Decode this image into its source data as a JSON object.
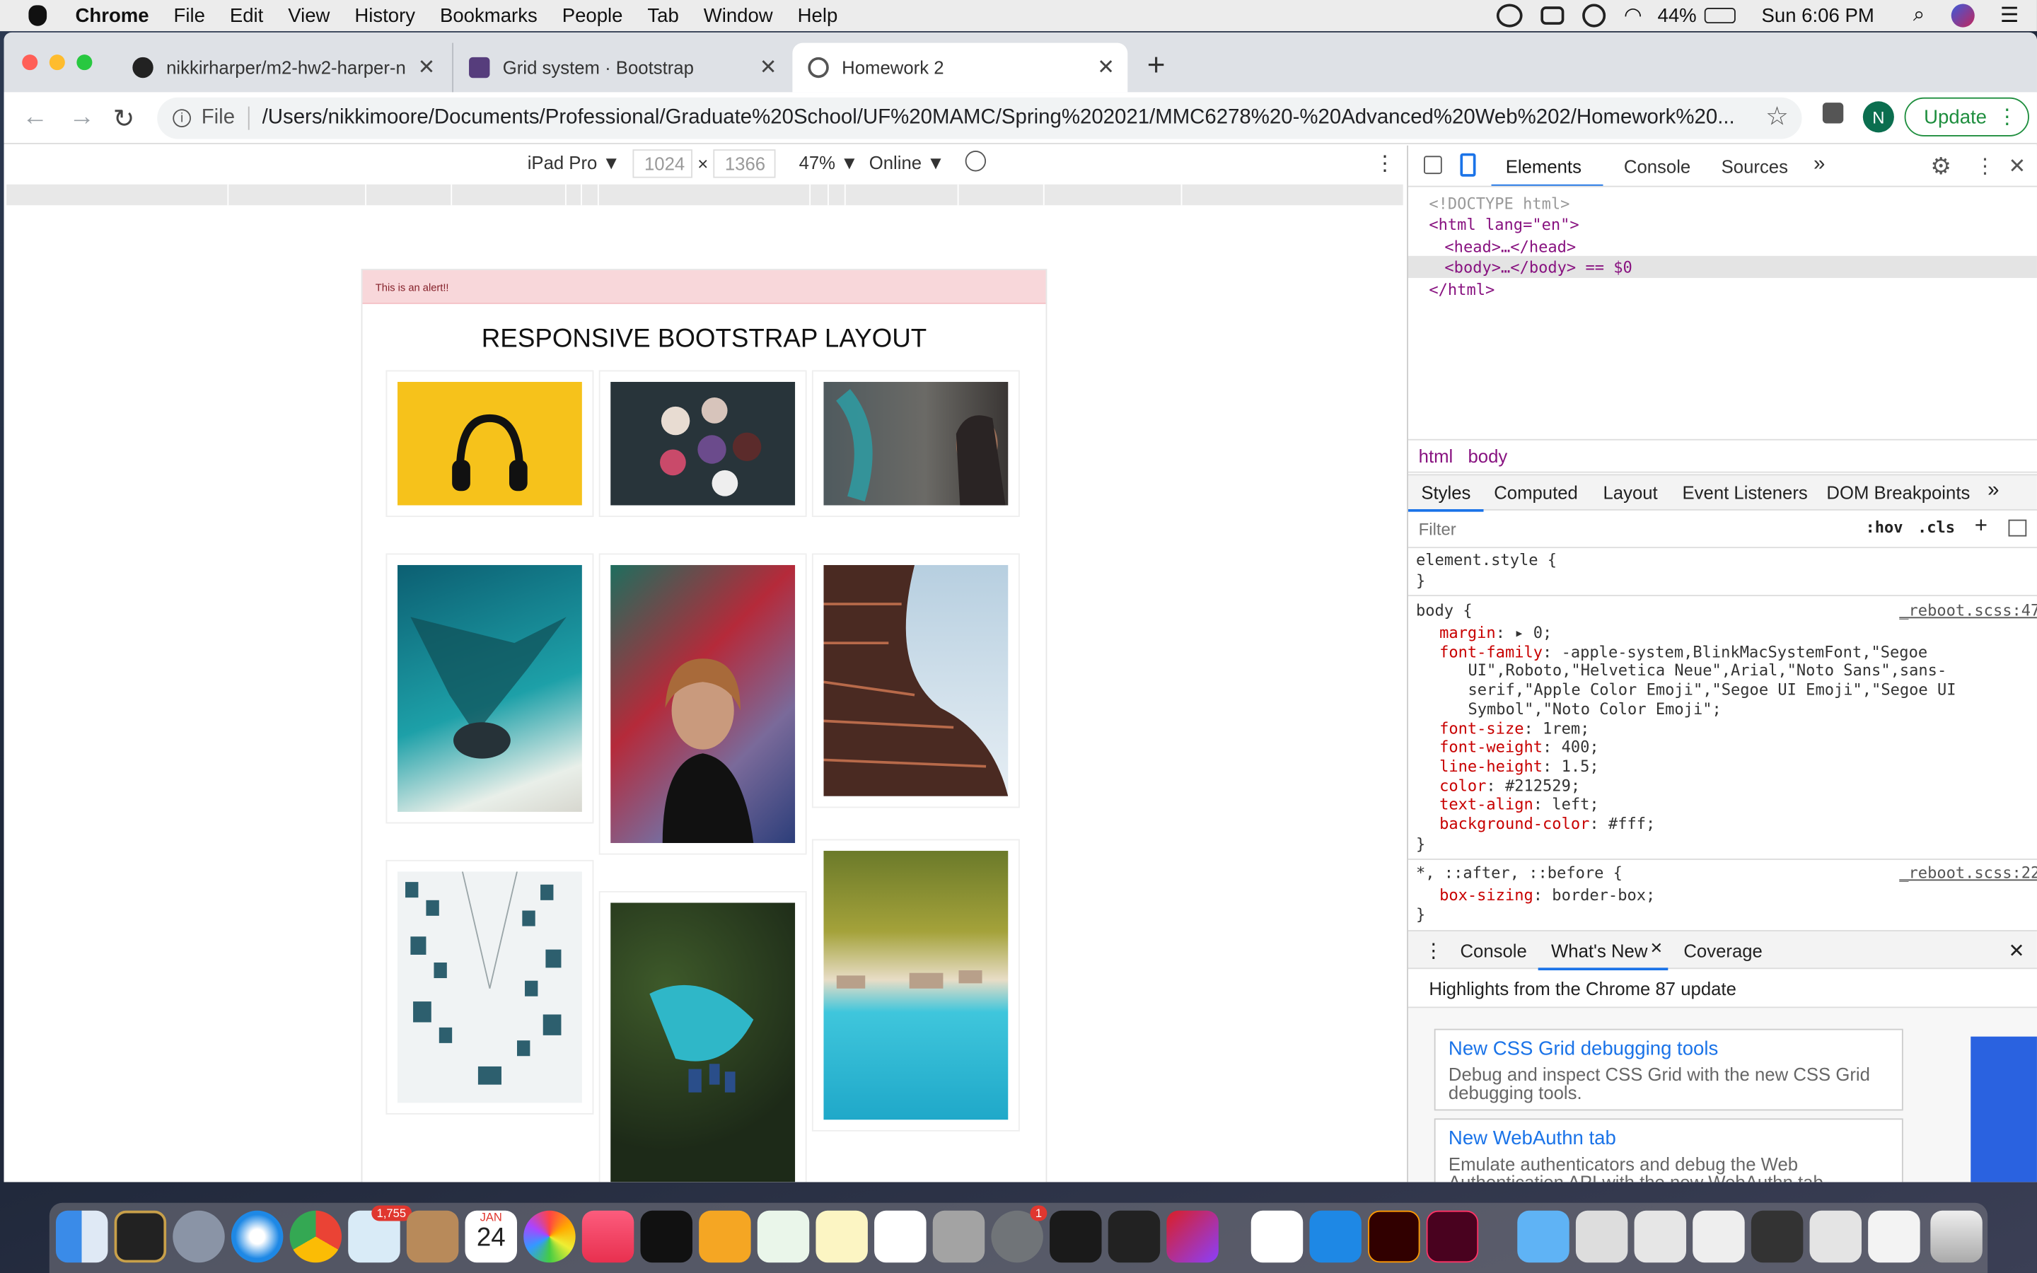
{
  "menubar": {
    "app": "Chrome",
    "items": [
      "File",
      "Edit",
      "View",
      "History",
      "Bookmarks",
      "People",
      "Tab",
      "Window",
      "Help"
    ],
    "battery": "44%",
    "clock": "Sun 6:06 PM"
  },
  "tabs": [
    {
      "title": "nikkirharper/m2-hw2-harper-n",
      "icon": "github-icon"
    },
    {
      "title": "Grid system · Bootstrap",
      "icon": "bootstrap-icon"
    },
    {
      "title": "Homework 2",
      "icon": "globe-icon"
    }
  ],
  "toolbar": {
    "scheme": "File",
    "url": "/Users/nikkimoore/Documents/Professional/Graduate%20School/UF%20MAMC/Spring%202021/MMC6278%20-%20Advanced%20Web%202/Homework%20...",
    "avatar": "N",
    "update": "Update"
  },
  "device": {
    "name": "iPad Pro ▼",
    "width": "1024",
    "x": "×",
    "height": "1366",
    "zoom": "47% ▼",
    "network": "Online ▼"
  },
  "page": {
    "alert": "This is an alert!!",
    "title": "RESPONSIVE BOOTSTRAP LAYOUT"
  },
  "devtools": {
    "tabs": [
      "Elements",
      "Console",
      "Sources",
      "»"
    ],
    "dom": [
      "<!DOCTYPE html>",
      "<html lang=\"en\">",
      "<head>…</head>",
      "<body>…</body> == $0",
      "</html>"
    ],
    "breadcrumb": [
      "html",
      "body"
    ],
    "style_tabs": [
      "Styles",
      "Computed",
      "Layout",
      "Event Listeners",
      "DOM Breakpoints",
      "»"
    ],
    "filter_placeholder": "Filter",
    "filter_tools": [
      ":hov",
      ".cls",
      "+"
    ],
    "element_style": "element.style {",
    "close_brace": "}",
    "body_rule": {
      "selector": "body {",
      "source": "_reboot.scss:47",
      "decls": [
        {
          "prop": "margin",
          "val": "▸ 0;"
        },
        {
          "prop": "font-family",
          "val": "-apple-system,BlinkMacSystemFont,\"Segoe"
        },
        {
          "prop": "",
          "val": "UI\",Roboto,\"Helvetica Neue\",Arial,\"Noto Sans\",sans-"
        },
        {
          "prop": "",
          "val": "serif,\"Apple Color Emoji\",\"Segoe UI Emoji\",\"Segoe UI"
        },
        {
          "prop": "",
          "val": "Symbol\",\"Noto Color Emoji\";"
        },
        {
          "prop": "font-size",
          "val": "1rem;"
        },
        {
          "prop": "font-weight",
          "val": "400;"
        },
        {
          "prop": "line-height",
          "val": "1.5;"
        },
        {
          "prop": "color",
          "val": "#212529;"
        },
        {
          "prop": "text-align",
          "val": "left;"
        },
        {
          "prop": "background-color",
          "val": "#fff;"
        }
      ]
    },
    "universal_rule": {
      "selector": "*, ::after, ::before {",
      "source": "_reboot.scss:22",
      "decl_prop": "box-sizing",
      "decl_val": "border-box;"
    },
    "drawer_tabs": [
      "Console",
      "What's New",
      "Coverage"
    ],
    "highlights": "Highlights from the Chrome 87 update",
    "news": [
      {
        "title": "New CSS Grid debugging tools",
        "desc": "Debug and inspect CSS Grid with the new CSS Grid debugging tools."
      },
      {
        "title": "New WebAuthn tab",
        "desc": "Emulate authenticators and debug the Web Authentication API with the new WebAuthn tab."
      }
    ]
  },
  "dock": {
    "mail_badge": "1,755",
    "prefs_badge": "1",
    "calendar_month": "JAN",
    "calendar_day": "24"
  }
}
